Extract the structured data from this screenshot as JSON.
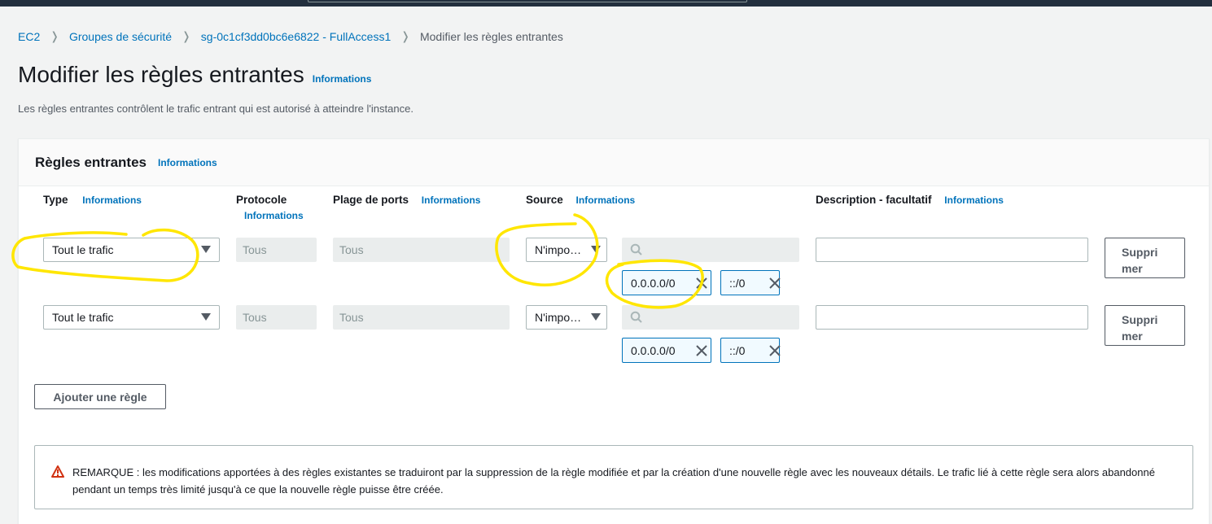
{
  "breadcrumb": {
    "items": [
      "EC2",
      "Groupes de sécurité",
      "sg-0c1cf3dd0bc6e6822 - FullAccess1"
    ],
    "current": "Modifier les règles entrantes"
  },
  "page": {
    "title": "Modifier les règles entrantes",
    "info": "Informations",
    "description": "Les règles entrantes contrôlent le trafic entrant qui est autorisé à atteindre l'instance."
  },
  "panel": {
    "title": "Règles entrantes",
    "info": "Informations",
    "columns": {
      "type": "Type",
      "protocol": "Protocole",
      "port_range": "Plage de ports",
      "source": "Source",
      "description": "Description - facultatif",
      "info": "Informations"
    },
    "rules": [
      {
        "type": "Tout le trafic",
        "protocol": "Tous",
        "port_range": "Tous",
        "source": "N'impo…",
        "search_value": "",
        "tokens": [
          "0.0.0.0/0",
          "::/0"
        ],
        "description": "",
        "delete_label_1": "Suppri",
        "delete_label_2": "mer"
      },
      {
        "type": "Tout le trafic",
        "protocol": "Tous",
        "port_range": "Tous",
        "source": "N'impo…",
        "search_value": "",
        "tokens": [
          "0.0.0.0/0",
          "::/0"
        ],
        "description": "",
        "delete_label_1": "Suppri",
        "delete_label_2": "mer"
      }
    ],
    "add_rule": "Ajouter une règle",
    "notice": "REMARQUE : les modifications apportées à des règles existantes se traduiront par la suppression de la règle modifiée et par la création d'une nouvelle règle avec les nouveaux détails. Le trafic lié à cette règle sera alors abandonné pendant un temps très limité jusqu'à ce que la nouvelle règle puisse être créée."
  },
  "colors": {
    "link": "#0073bb",
    "nav": "#232f3e",
    "warning": "#d13212",
    "annotation": "#ffe600"
  }
}
